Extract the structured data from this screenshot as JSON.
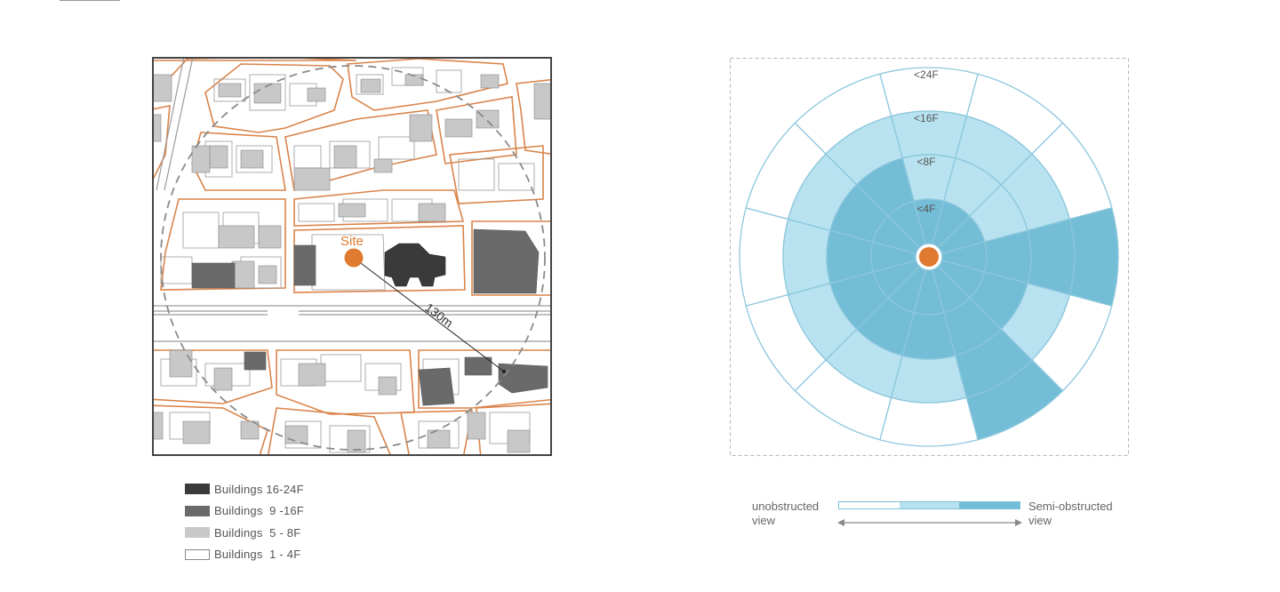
{
  "map": {
    "site_label": "Site",
    "distance_label": "130m"
  },
  "radial": {
    "ring_labels": [
      "<24F",
      "<16F",
      "<8F",
      "<4F"
    ]
  },
  "legend": {
    "items": [
      {
        "label": "Buildings 16-24F",
        "color": "#3a3a3a"
      },
      {
        "label": "Buildings  9 -16F",
        "color": "#6a6a6a"
      },
      {
        "label": "Buildings  5 - 8F",
        "color": "#c8c8c8"
      },
      {
        "label": "Buildings  1 - 4F",
        "color": "#ffffff"
      }
    ]
  },
  "scale": {
    "left_line1": "unobstructed",
    "left_line2": "view",
    "right_line1": "Semi-obstructed",
    "right_line2": "view",
    "colors": [
      "#ffffff",
      "#b8e2f0",
      "#74bdd6"
    ]
  },
  "colors": {
    "site": "#e07a30",
    "road": "#d9844a",
    "ring_stroke": "#8cc7dc",
    "light_blue": "#b8e2f0",
    "dark_blue": "#74bdd6"
  }
}
